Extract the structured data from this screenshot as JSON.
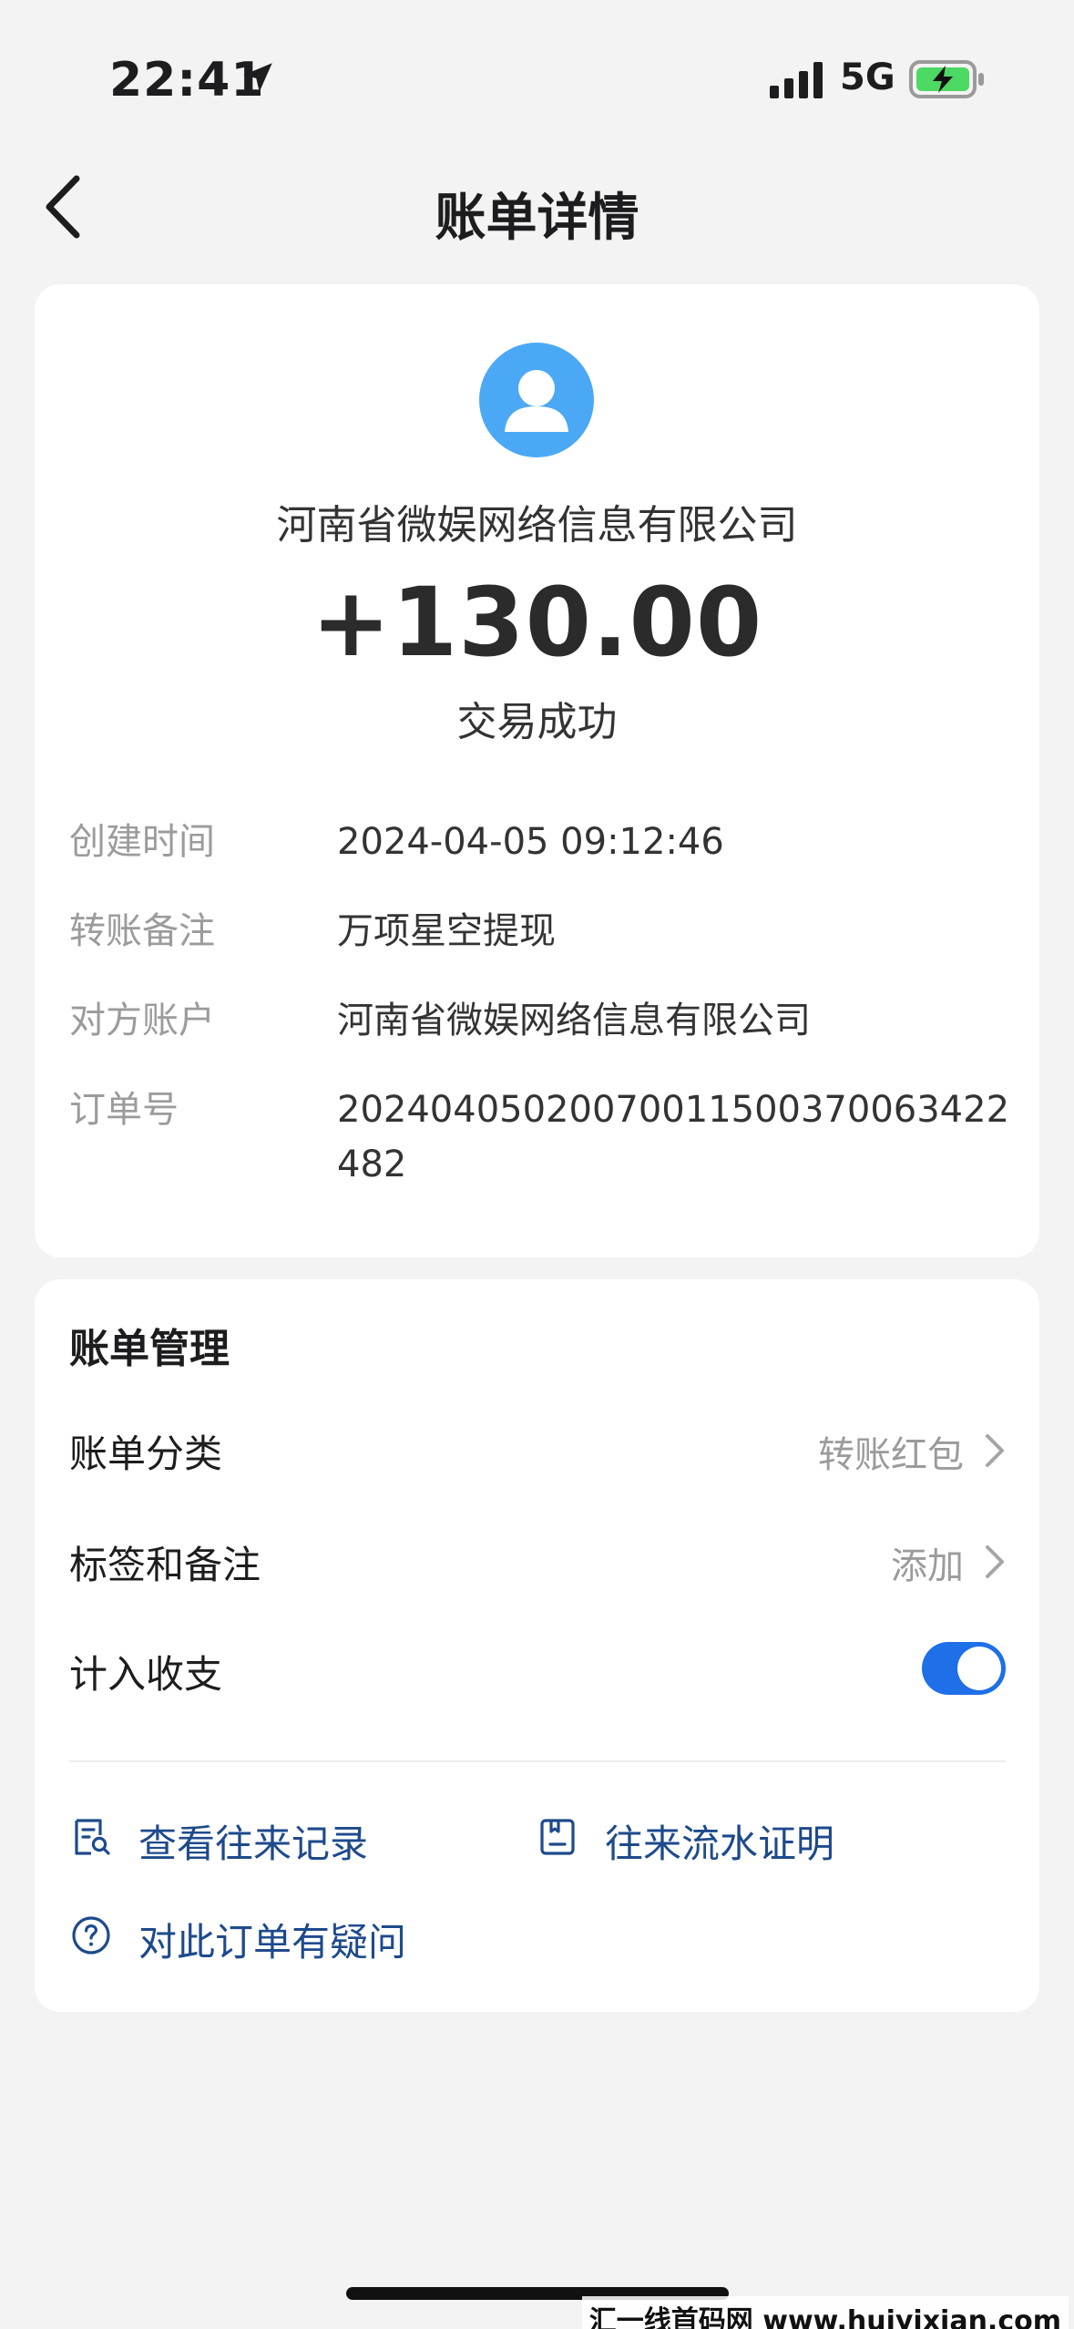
{
  "status_bar": {
    "time": "22:41",
    "network": "5G"
  },
  "nav": {
    "title": "账单详情"
  },
  "transaction": {
    "merchant": "河南省微娱网络信息有限公司",
    "amount": "+130.00",
    "status": "交易成功",
    "details": [
      {
        "label": "创建时间",
        "value": "2024-04-05 09:12:46"
      },
      {
        "label": "转账备注",
        "value": "万项星空提现"
      },
      {
        "label": "对方账户",
        "value": "河南省微娱网络信息有限公司"
      },
      {
        "label": "订单号",
        "value": "20240405020070011500370063422482"
      }
    ]
  },
  "management": {
    "title": "账单管理",
    "category": {
      "label": "账单分类",
      "value": "转账红包"
    },
    "tags": {
      "label": "标签和备注",
      "value": "添加"
    },
    "include": {
      "label": "计入收支",
      "enabled": true
    },
    "links": {
      "history": "查看往来记录",
      "proof": "往来流水证明",
      "question": "对此订单有疑问"
    }
  },
  "watermark": "汇一线首码网 www.huiyixian.com",
  "colors": {
    "accent": "#1e6fe8",
    "link": "#1e4a8c",
    "avatar": "#4ba8f5",
    "battery": "#4cd964"
  }
}
